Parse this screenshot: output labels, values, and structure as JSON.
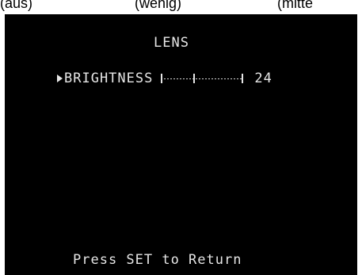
{
  "captions": [
    "(aus)",
    "(wenig)",
    "(mitte"
  ],
  "menu": {
    "title": "LENS",
    "item": {
      "label": "BRIGHTNESS",
      "value": "24",
      "slider_level": 0.4
    },
    "footer": "Press SET to Return"
  },
  "colors": {
    "screen_bg": "#000000",
    "osd_text": "#e6e6e6",
    "caption_text": "#000000"
  },
  "icons": {
    "cursor": "right-triangle-cursor-icon"
  }
}
